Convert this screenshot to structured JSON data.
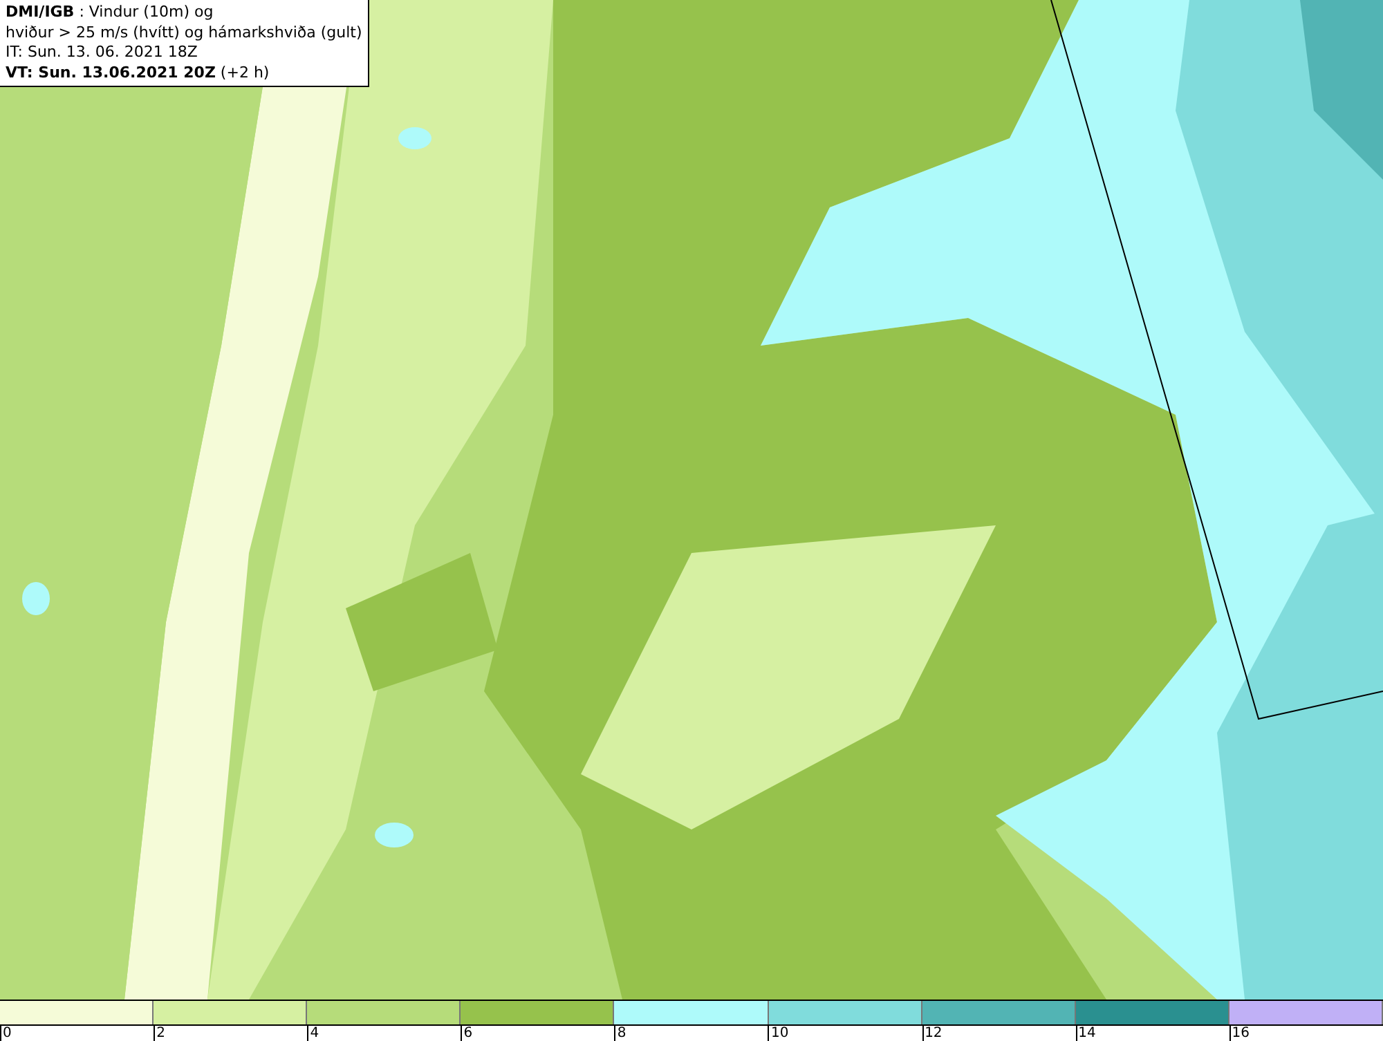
{
  "header": {
    "lines": [
      "**DMI/IGB** : Vindur (10m) og",
      "hviður > 25 m/s (hvítt) og hámarkshviða (gult)",
      "IT: Sun. 13. 06. 2021 18Z",
      "**VT: Sun. 13.06.2021 20Z** (+2 h)"
    ]
  },
  "legend": {
    "bins": [
      {
        "color": "#f5fbd8"
      },
      {
        "color": "#d6f0a2"
      },
      {
        "color": "#b6dc7a"
      },
      {
        "color": "#96c24c"
      },
      {
        "color": "#aefafa"
      },
      {
        "color": "#80dcdc"
      },
      {
        "color": "#52b4b4"
      },
      {
        "color": "#2a9090"
      },
      {
        "color": "#c0b0f6"
      }
    ],
    "ticks": [
      "0",
      "2",
      "4",
      "6",
      "8",
      "10",
      "12",
      "14",
      "16"
    ]
  }
}
